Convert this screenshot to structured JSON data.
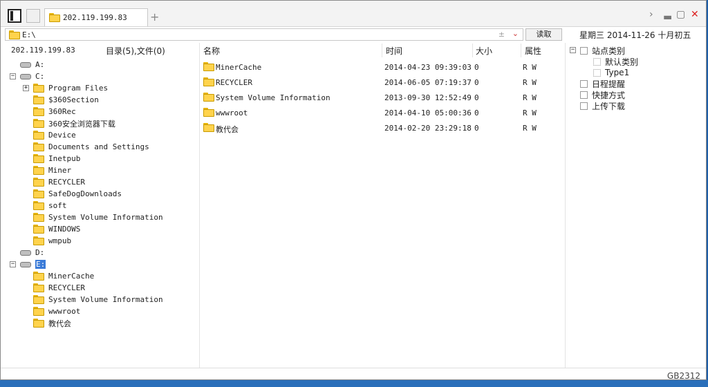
{
  "tab": {
    "title": "202.119.199.83"
  },
  "address": {
    "path": "E:\\",
    "read_label": "读取"
  },
  "date": "星期三  2014-11-26  十月初五",
  "left_header": {
    "host": "202.119.199.83",
    "summary": "目录(5),文件(0)"
  },
  "columns": {
    "name": "名称",
    "time": "时间",
    "size": "大小",
    "attr": "属性"
  },
  "tree": [
    {
      "label": "A:",
      "type": "drive",
      "depth": 0
    },
    {
      "label": "C:",
      "type": "drive",
      "depth": 0,
      "expander": "−"
    },
    {
      "label": "Program Files",
      "type": "folder",
      "depth": 1,
      "expander": "+"
    },
    {
      "label": "$360Section",
      "type": "folder",
      "depth": 1
    },
    {
      "label": "360Rec",
      "type": "folder",
      "depth": 1
    },
    {
      "label": "360安全浏览器下载",
      "type": "folder",
      "depth": 1
    },
    {
      "label": "Device",
      "type": "folder",
      "depth": 1
    },
    {
      "label": "Documents and Settings",
      "type": "folder",
      "depth": 1
    },
    {
      "label": "Inetpub",
      "type": "folder",
      "depth": 1
    },
    {
      "label": "Miner",
      "type": "folder",
      "depth": 1
    },
    {
      "label": "RECYCLER",
      "type": "folder",
      "depth": 1
    },
    {
      "label": "SafeDogDownloads",
      "type": "folder",
      "depth": 1
    },
    {
      "label": "soft",
      "type": "folder",
      "depth": 1
    },
    {
      "label": "System Volume Information",
      "type": "folder",
      "depth": 1
    },
    {
      "label": "WINDOWS",
      "type": "folder",
      "depth": 1
    },
    {
      "label": "wmpub",
      "type": "folder",
      "depth": 1
    },
    {
      "label": "D:",
      "type": "drive",
      "depth": 0
    },
    {
      "label": "E:",
      "type": "drive",
      "depth": 0,
      "expander": "−",
      "selected": true
    },
    {
      "label": "MinerCache",
      "type": "folder",
      "depth": 1
    },
    {
      "label": "RECYCLER",
      "type": "folder",
      "depth": 1
    },
    {
      "label": "System Volume Information",
      "type": "folder",
      "depth": 1
    },
    {
      "label": "wwwroot",
      "type": "folder",
      "depth": 1
    },
    {
      "label": "教代会",
      "type": "folder",
      "depth": 1
    }
  ],
  "files": [
    {
      "name": "MinerCache",
      "time": "2014-04-23 09:39:03",
      "size": "0",
      "attr": "R W"
    },
    {
      "name": "RECYCLER",
      "time": "2014-06-05 07:19:37",
      "size": "0",
      "attr": "R W"
    },
    {
      "name": "System Volume Information",
      "time": "2013-09-30 12:52:49",
      "size": "0",
      "attr": "R W"
    },
    {
      "name": "wwwroot",
      "time": "2014-04-10 05:00:36",
      "size": "0",
      "attr": "R W"
    },
    {
      "name": "教代会",
      "time": "2014-02-20 23:29:18",
      "size": "0",
      "attr": "R W"
    }
  ],
  "right_tree": [
    {
      "label": "站点类别",
      "depth": 0,
      "expander": "−",
      "icon": "box"
    },
    {
      "label": "默认类别",
      "depth": 1,
      "icon": "dotted"
    },
    {
      "label": "Type1",
      "depth": 1,
      "icon": "dotted"
    },
    {
      "label": "日程提醒",
      "depth": 0,
      "icon": "clock"
    },
    {
      "label": "快捷方式",
      "depth": 0,
      "icon": "doc"
    },
    {
      "label": "上传下载",
      "depth": 0,
      "icon": "box"
    }
  ],
  "status": {
    "encoding": "GB2312"
  }
}
